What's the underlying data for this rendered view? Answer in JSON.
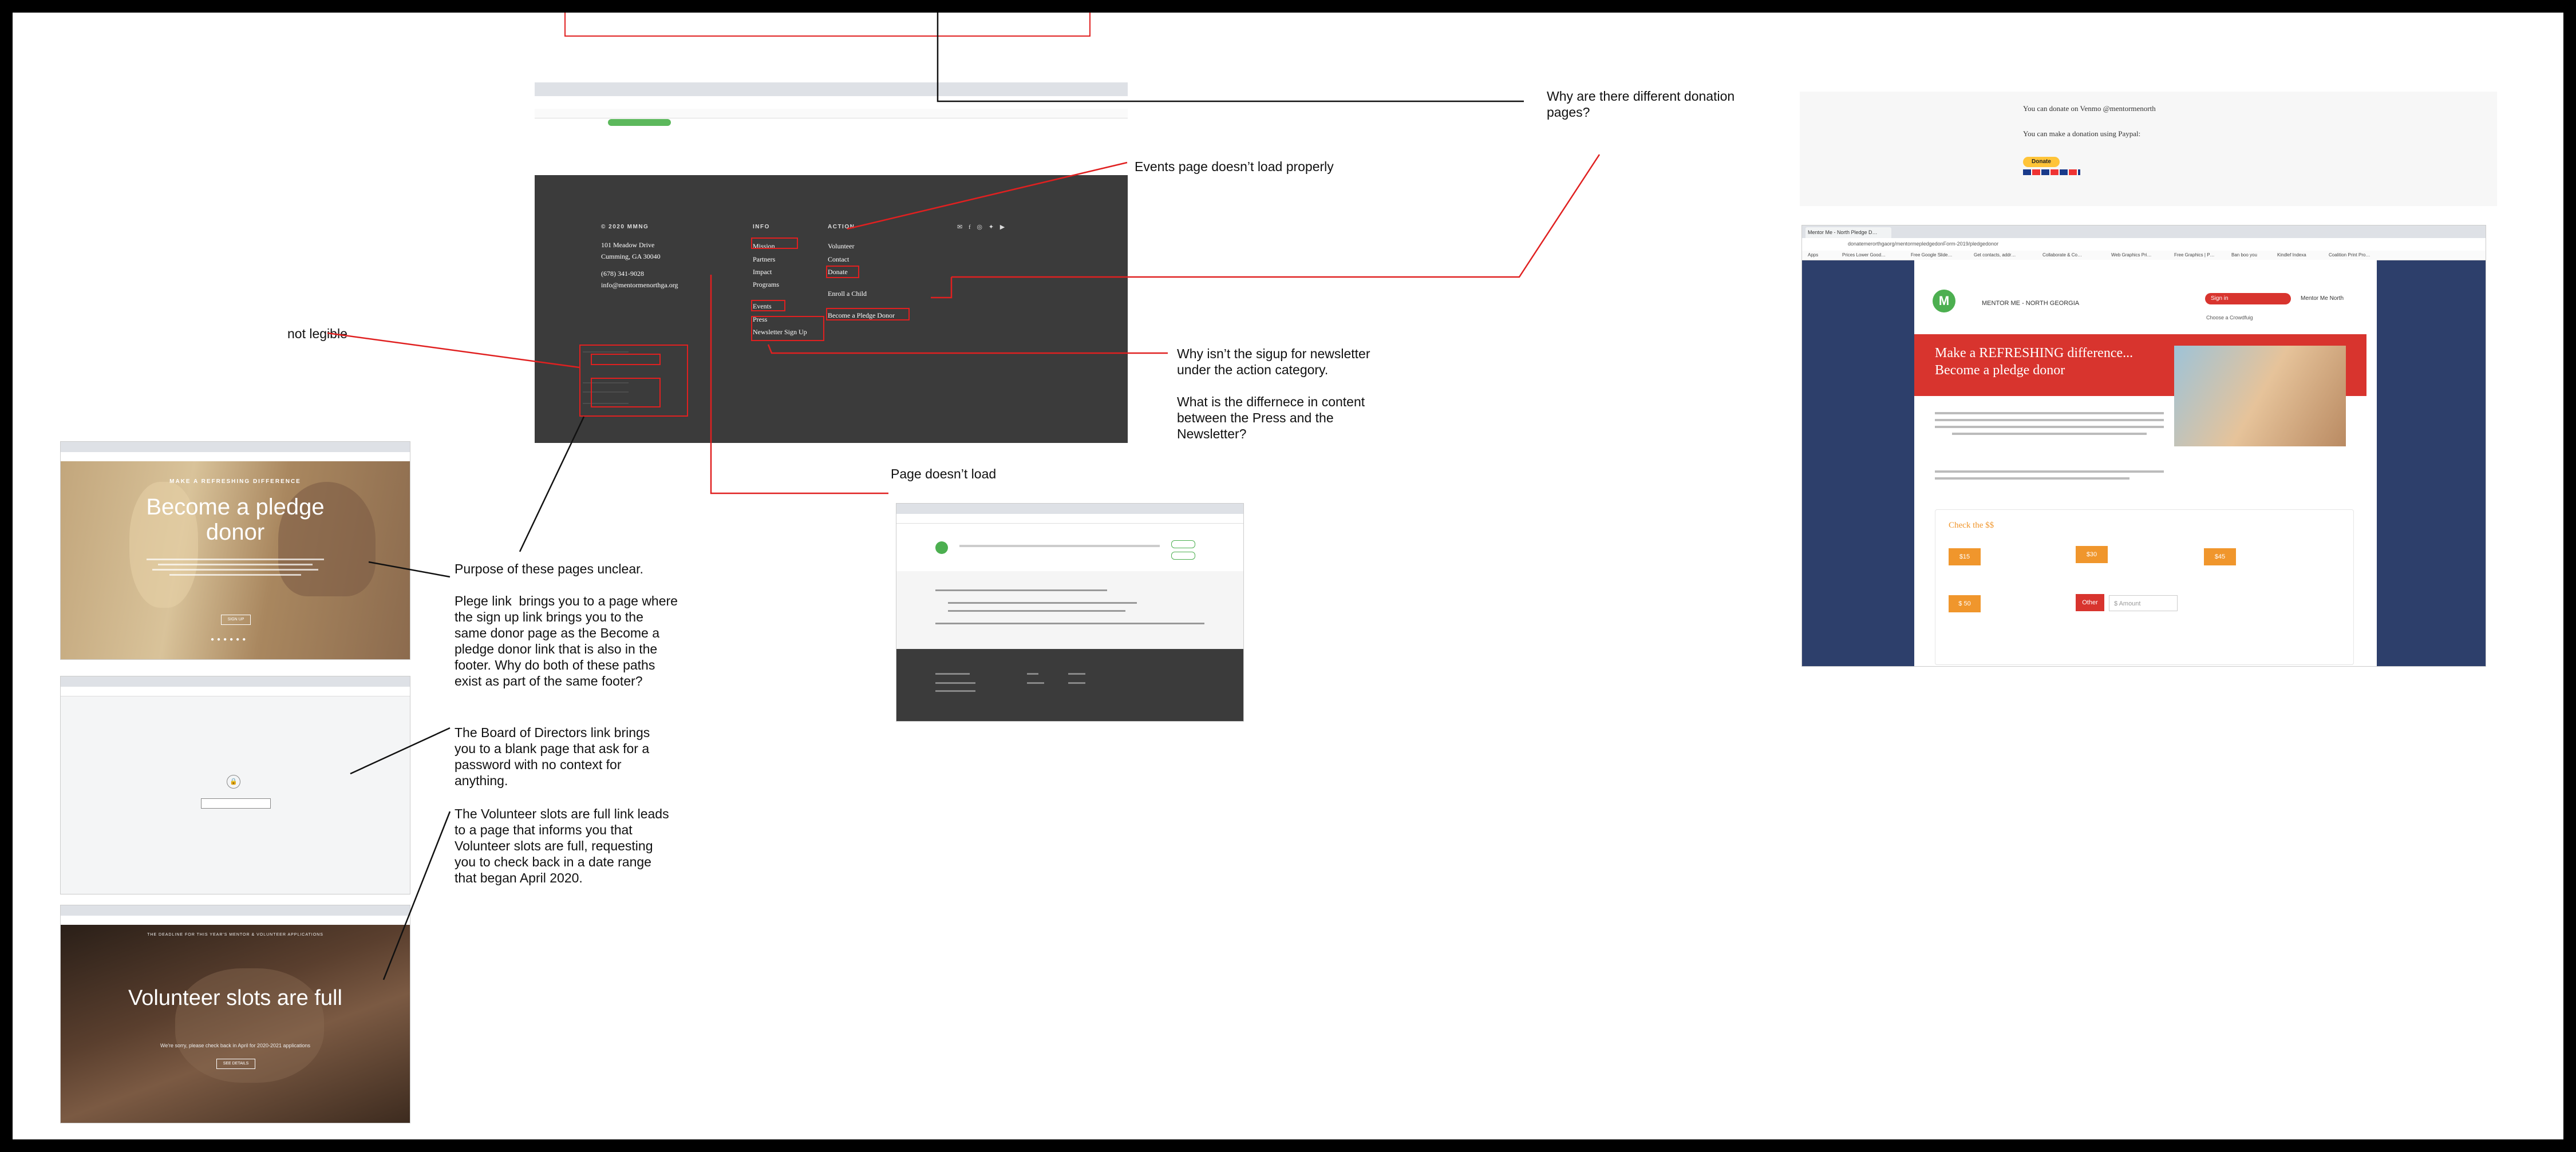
{
  "annotations": {
    "donation_pages": "Why are there different donation pages?",
    "events_page": "Events page doesn’t load properly",
    "not_legible": "not legible",
    "signup_newsletter": "Why isn’t the sigup for newsletter under the action category.\n\nWhat is the differnece in content between the Press and the Newsletter?",
    "page_doesnt_load": "Page doesn’t load",
    "purpose_unclear": "Purpose of these pages unclear.\n\nPlege link  brings you to a page where the sign up link brings you to the same donor page as the Become a pledge donor link that is also in the footer. Why do both of these paths exist as part of the same footer?",
    "board_directors": "The Board of Directors link brings you to a blank page that ask for a password with no context for anything.",
    "volunteer_full": "The Volunteer slots are full link leads to a page that informs you that Volunteer slots are full, requesting you to check back in a date range that began April 2020."
  },
  "footer": {
    "org": "© 2020 MMNG",
    "address1": "101 Meadow Drive",
    "address2": "Cumming, GA 30040",
    "phone": "(678) 341-9028",
    "email": "info@mentormenorthga.org",
    "info_heading": "INFO",
    "action_heading": "ACTION",
    "info_links": [
      "Mission",
      "Partners",
      "Impact",
      "Programs",
      "Events",
      "Press",
      "Newsletter Sign Up"
    ],
    "action_links": [
      "Volunteer",
      "Contact",
      "Donate",
      "Enroll a Child",
      "Become a Pledge Donor"
    ]
  },
  "bookmarks": [
    "Apps",
    "Prices Lower Good…",
    "Free Google Slide…",
    "Get contacts, addr…",
    "Collaborate & Co…",
    "Web Graphics Pri…",
    "Free Graphics | P…",
    "Ban boo you",
    "Kindlef Indexa",
    "Coalition Print Pro…"
  ],
  "pledge_shot": {
    "eyebrow": "MAKE A REFRESHING DIFFERENCE",
    "title": "Become a pledge donor",
    "button": "SIGN UP"
  },
  "volunteer_shot": {
    "eyebrow": "THE DEADLINE FOR THIS YEAR'S MENTOR & VOLUNTEER APPLICATIONS",
    "title": "Volunteer slots are full",
    "subtitle": "We're sorry, please check back in April for 2020-2021 applications",
    "button": "SEE DETAILS"
  },
  "donate_page": {
    "top_text1": "You can donate on Venmo @mentormenorth",
    "top_text2": "You can make a donation using Paypal:",
    "donate_button": "Donate",
    "tab_title": "Mentor Me - North Pledge D…",
    "url": "donatemerorthgaorg/mentormepledgedonForm-2019/pledgedonor",
    "org_name": "MENTOR ME - NORTH GEORGIA",
    "signin": "Sign in",
    "nav_link": "Mentor Me North",
    "cart_text": "Choose a Crowdfuig",
    "headline": "Make a REFRESHING difference... Become a pledge donor",
    "section_title": "Check the $$",
    "amounts": [
      "$15",
      "$30",
      "$45",
      "$ 50"
    ],
    "other_button": "Other",
    "amount_placeholder": "$ Amount"
  },
  "colors": {
    "accent_red": "#e02020",
    "footer_bg": "#3b3b3b",
    "navy": "#2d3f6b",
    "mmng_green": "#4caf50",
    "donate_red": "#d8342e",
    "amount_orange": "#f0962c"
  }
}
